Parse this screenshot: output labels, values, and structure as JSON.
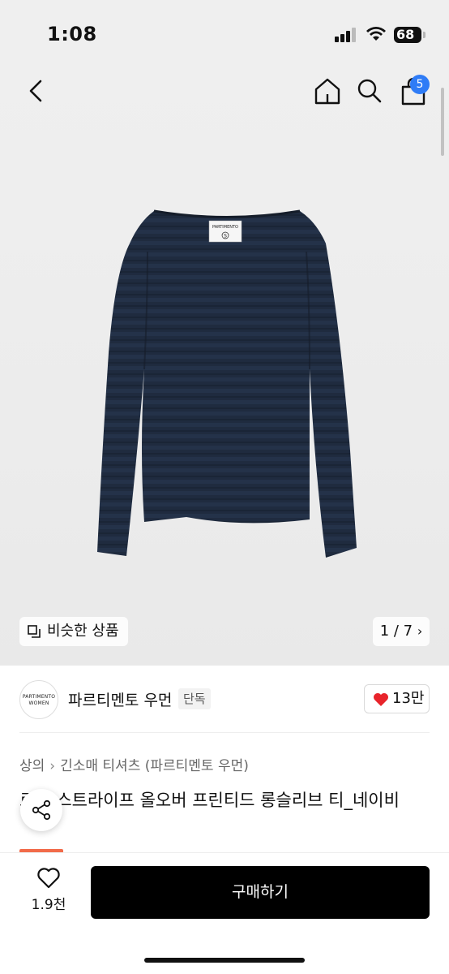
{
  "status_bar": {
    "time": "1:08",
    "battery": "68"
  },
  "nav": {
    "cart_count": "5"
  },
  "hero": {
    "label_brand": "PARTIMENTO",
    "label_size": "S",
    "similar_label": "비슷한 상품",
    "counter": "1 / 7"
  },
  "seller": {
    "logo_line1": "PARTIMENTO",
    "logo_line2": "WOMEN",
    "name": "파르티멘토 우먼",
    "badge": "단독",
    "likes": "13만"
  },
  "breadcrumb": {
    "level1": "상의",
    "level2": "긴소매 티셔츠 (파르티멘토 우먼)"
  },
  "product": {
    "title": "로고 스트라이프 올오버 프린티드 롱슬리브 티_네이비"
  },
  "bottom": {
    "wish_count": "1.9천",
    "buy_label": "구매하기"
  },
  "colors": {
    "accent_blue": "#2f7cf6",
    "heart_red": "#e8242b",
    "garment_navy": "#1e2a3e",
    "buy_black": "#000000"
  }
}
